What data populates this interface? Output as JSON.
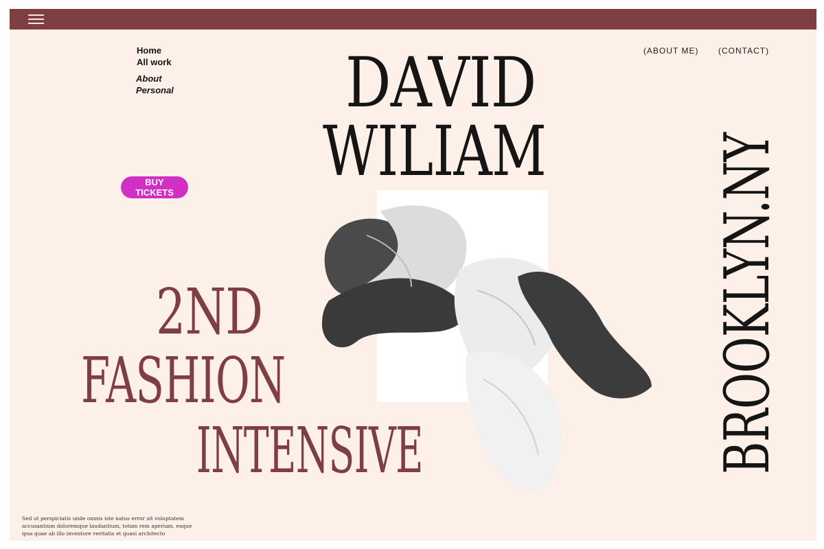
{
  "header": {
    "menu_icon": "hamburger-menu-icon",
    "color": "#7f3f42"
  },
  "nav": {
    "items": [
      {
        "label": "Home",
        "italic": false
      },
      {
        "label": "All work",
        "italic": false
      },
      {
        "label": "About",
        "italic": true
      },
      {
        "label": "Personal",
        "italic": true
      }
    ]
  },
  "top_links": {
    "about": "(ABOUT ME)",
    "contact": "(CONTACT)"
  },
  "hero": {
    "name_line1": "DAVID",
    "name_line2": "WILIAM",
    "event_line1": "2ND",
    "event_line2": "FASHION",
    "event_line3": "INTENSIVE",
    "location": "BROOKLYN.NY"
  },
  "cta": {
    "label": "BUY TICKETS",
    "color": "#d22fc4"
  },
  "blurb": "Sed ut perspiciatis unde omnis iste natus error sit voluptatem accusantium doloremque laudantium, totam rem aperiam, eaque ipsa quae ab illo inventore veritatis et quasi architecto",
  "colors": {
    "background": "#fdf0e8",
    "accent": "#7f3f42",
    "text": "#151515"
  }
}
